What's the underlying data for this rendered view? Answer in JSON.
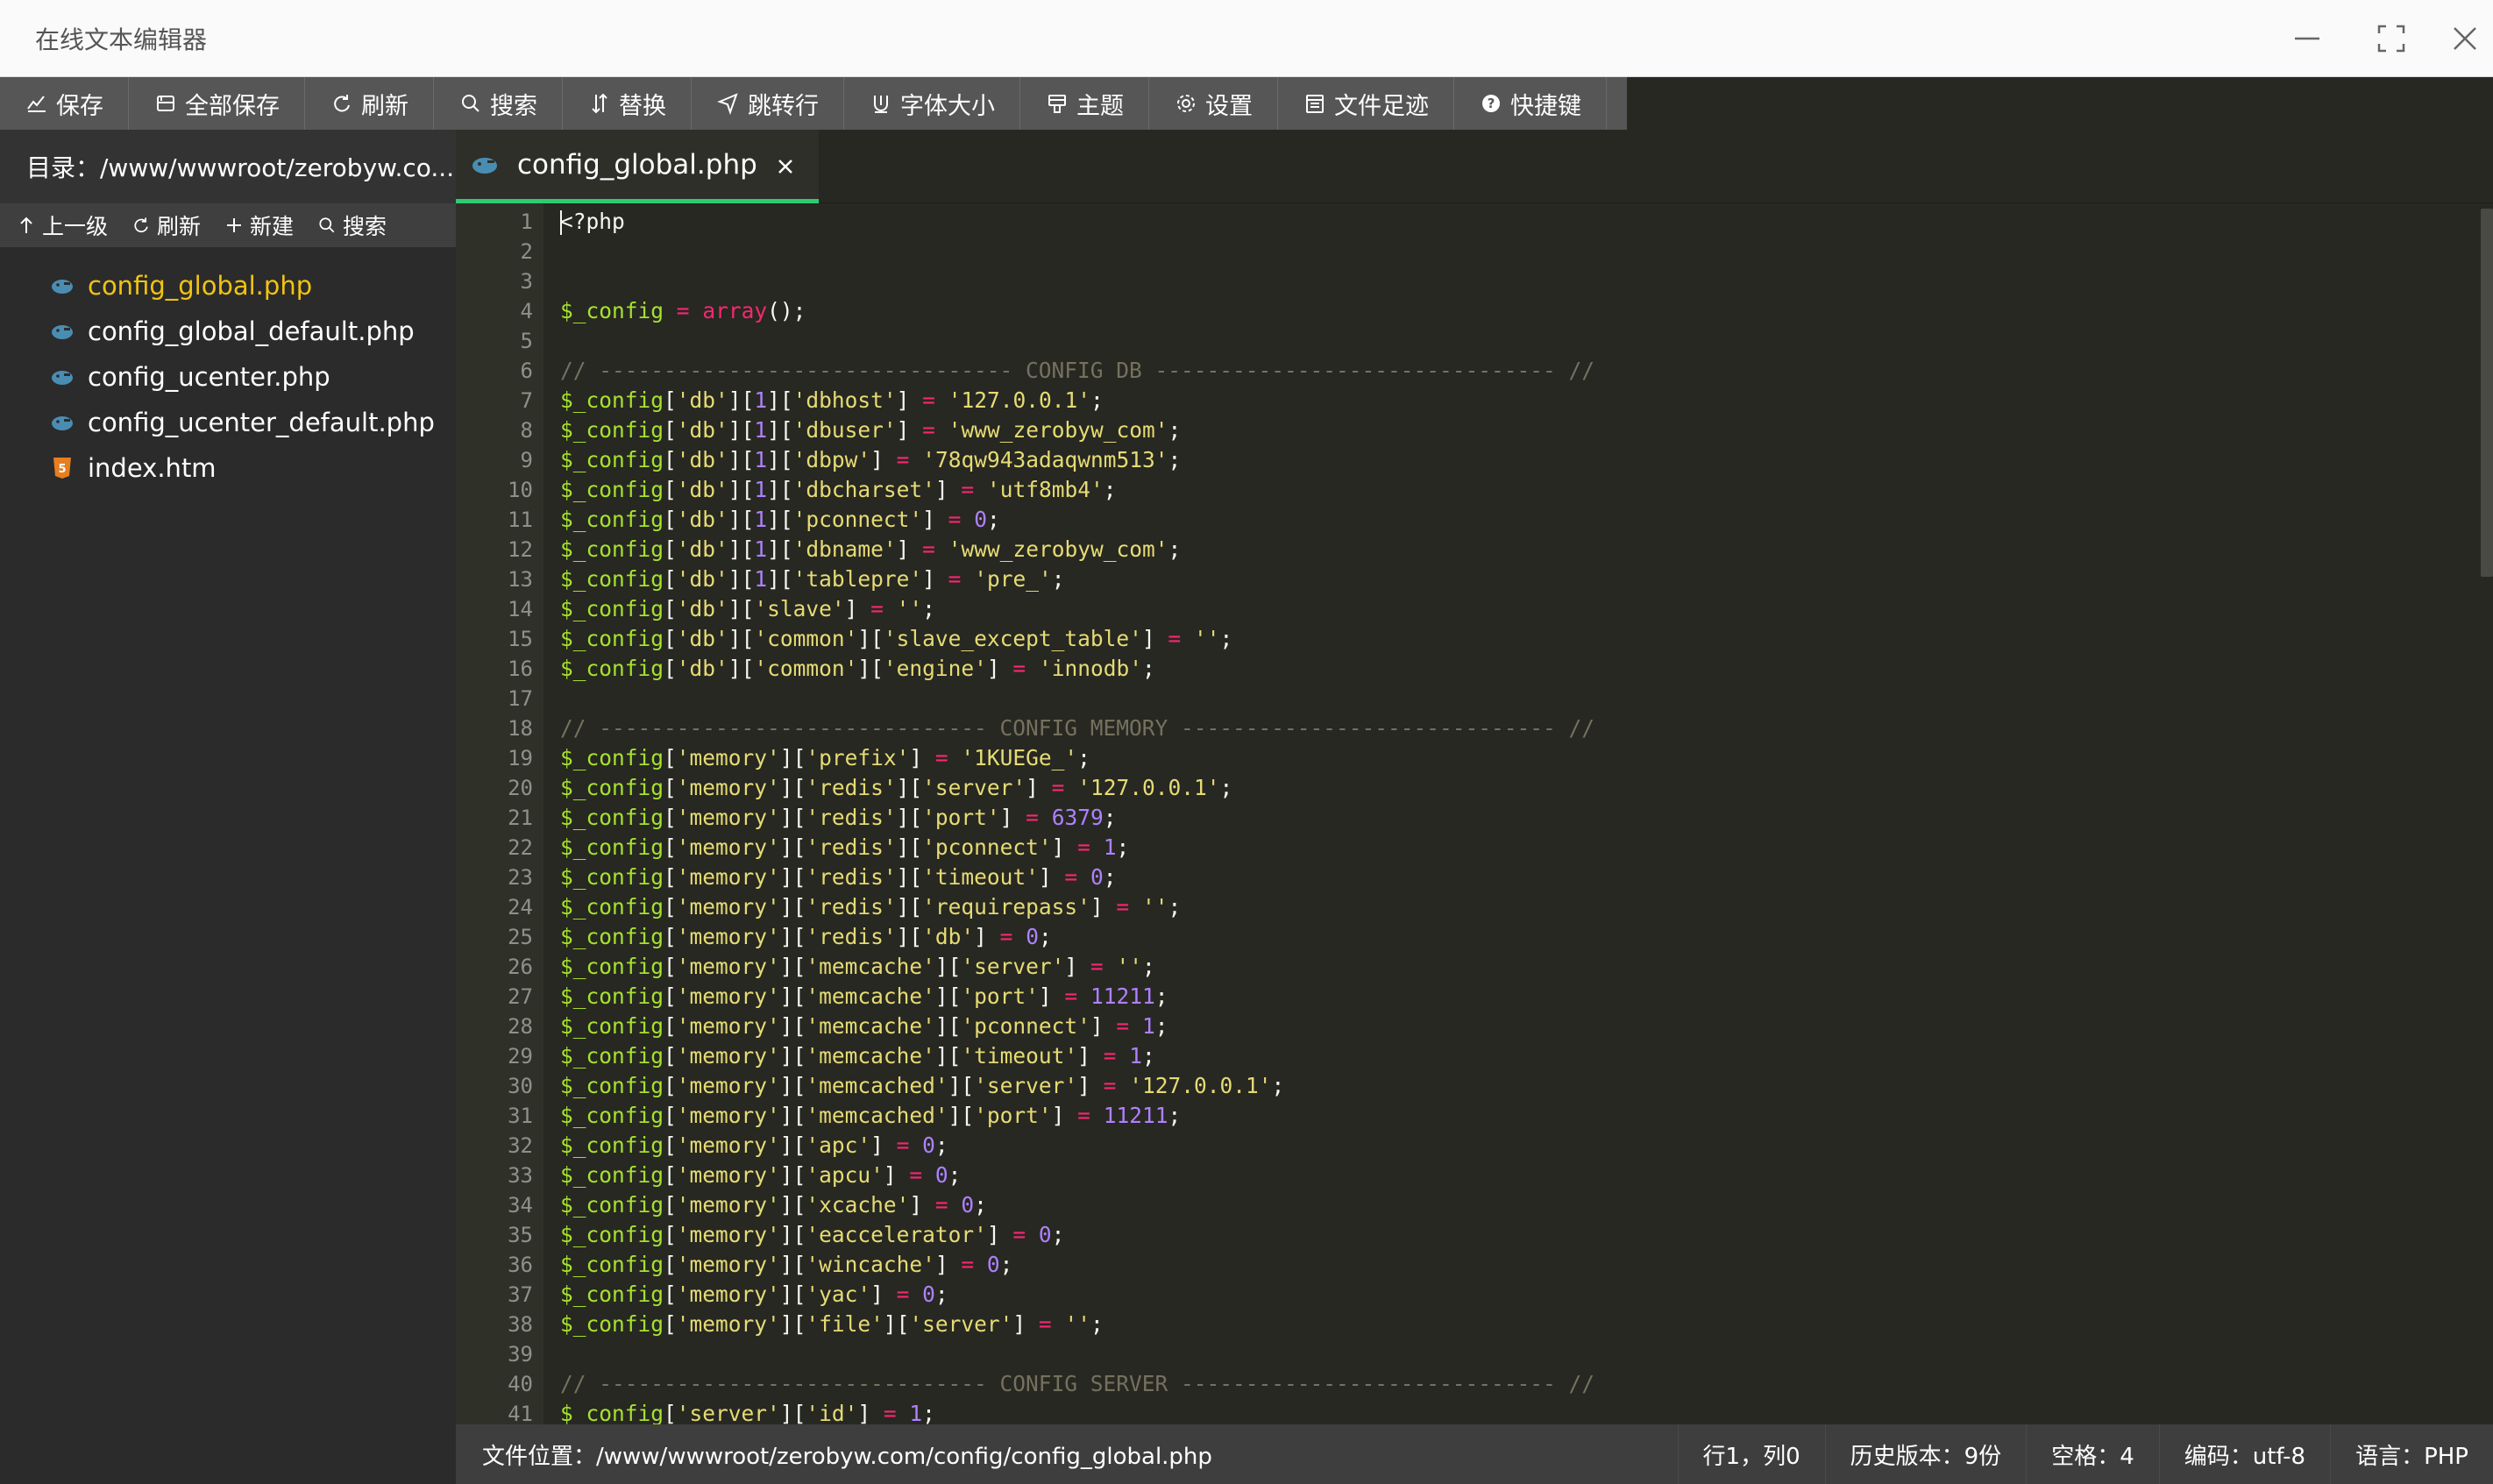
{
  "window": {
    "title": "在线文本编辑器"
  },
  "toolbar": [
    {
      "label": "保存",
      "icon": "save-icon"
    },
    {
      "label": "全部保存",
      "icon": "save-all-icon"
    },
    {
      "label": "刷新",
      "icon": "refresh-icon"
    },
    {
      "label": "搜索",
      "icon": "search-icon"
    },
    {
      "label": "替换",
      "icon": "replace-icon"
    },
    {
      "label": "跳转行",
      "icon": "jump-icon"
    },
    {
      "label": "字体大小",
      "icon": "font-size-icon"
    },
    {
      "label": "主题",
      "icon": "theme-icon"
    },
    {
      "label": "设置",
      "icon": "gear-icon"
    },
    {
      "label": "文件足迹",
      "icon": "history-icon"
    },
    {
      "label": "快捷键",
      "icon": "help-icon"
    }
  ],
  "sidebar": {
    "directory": "目录：/www/wwwroot/zerobyw.co...",
    "actions": [
      {
        "label": "上一级",
        "icon": "arrow-up-icon"
      },
      {
        "label": "刷新",
        "icon": "refresh-icon"
      },
      {
        "label": "新建",
        "icon": "plus-icon"
      },
      {
        "label": "搜索",
        "icon": "search-icon"
      }
    ],
    "files": [
      {
        "name": "config_global.php",
        "icon": "php-icon",
        "active": true
      },
      {
        "name": "config_global_default.php",
        "icon": "php-icon",
        "active": false
      },
      {
        "name": "config_ucenter.php",
        "icon": "php-icon",
        "active": false
      },
      {
        "name": "config_ucenter_default.php",
        "icon": "php-icon",
        "active": false
      },
      {
        "name": "index.htm",
        "icon": "html5-icon",
        "active": false
      }
    ]
  },
  "tab": {
    "label": "config_global.php"
  },
  "editor": {
    "lines": [
      "<?php",
      "",
      "",
      "$_config = array();",
      "",
      "// -------------------------------- CONFIG DB ------------------------------- //",
      "$_config['db'][1]['dbhost'] = '127.0.0.1';",
      "$_config['db'][1]['dbuser'] = 'www_zerobyw_com';",
      "$_config['db'][1]['dbpw'] = '78qw943adaqwnm513';",
      "$_config['db'][1]['dbcharset'] = 'utf8mb4';",
      "$_config['db'][1]['pconnect'] = 0;",
      "$_config['db'][1]['dbname'] = 'www_zerobyw_com';",
      "$_config['db'][1]['tablepre'] = 'pre_';",
      "$_config['db']['slave'] = '';",
      "$_config['db']['common']['slave_except_table'] = '';",
      "$_config['db']['common']['engine'] = 'innodb';",
      "",
      "// ------------------------------ CONFIG MEMORY ----------------------------- //",
      "$_config['memory']['prefix'] = '1KUEGe_';",
      "$_config['memory']['redis']['server'] = '127.0.0.1';",
      "$_config['memory']['redis']['port'] = 6379;",
      "$_config['memory']['redis']['pconnect'] = 1;",
      "$_config['memory']['redis']['timeout'] = 0;",
      "$_config['memory']['redis']['requirepass'] = '';",
      "$_config['memory']['redis']['db'] = 0;",
      "$_config['memory']['memcache']['server'] = '';",
      "$_config['memory']['memcache']['port'] = 11211;",
      "$_config['memory']['memcache']['pconnect'] = 1;",
      "$_config['memory']['memcache']['timeout'] = 1;",
      "$_config['memory']['memcached']['server'] = '127.0.0.1';",
      "$_config['memory']['memcached']['port'] = 11211;",
      "$_config['memory']['apc'] = 0;",
      "$_config['memory']['apcu'] = 0;",
      "$_config['memory']['xcache'] = 0;",
      "$_config['memory']['eaccelerator'] = 0;",
      "$_config['memory']['wincache'] = 0;",
      "$_config['memory']['yac'] = 0;",
      "$_config['memory']['file']['server'] = '';",
      "",
      "// ------------------------------ CONFIG SERVER ----------------------------- //",
      "$_config['server']['id'] = 1;"
    ]
  },
  "status": {
    "path": "文件位置：/www/wwwroot/zerobyw.com/config/config_global.php",
    "position": "行1，列0",
    "history": "历史版本：9份",
    "indent": "空格：4",
    "encoding": "编码：utf-8",
    "language": "语言：PHP"
  },
  "colors": {
    "accent": "#2ecc71",
    "active_file": "#f1c40f",
    "editor_bg": "#272822",
    "variable": "#a6e22e",
    "string": "#e6db74",
    "number": "#ae81ff",
    "keyword": "#f92672",
    "comment": "#75715e"
  }
}
